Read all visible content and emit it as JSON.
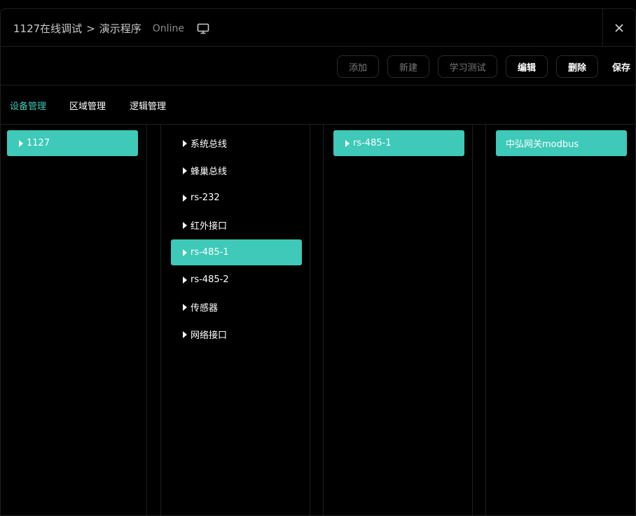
{
  "header": {
    "breadcrumb_root": "1127在线调试",
    "breadcrumb_sep": ">",
    "breadcrumb_current": "演示程序",
    "status": "Online",
    "monitor_icon": "monitor-icon",
    "close_icon": "close-icon"
  },
  "toolbar": {
    "add_label": "添加",
    "new_label": "新建",
    "learn_test_label": "学习测试",
    "edit_label": "编辑",
    "delete_label": "删除",
    "save_label": "保存"
  },
  "tabs": [
    {
      "label": "设备管理",
      "active": true
    },
    {
      "label": "区域管理",
      "active": false
    },
    {
      "label": "逻辑管理",
      "active": false
    }
  ],
  "columns": {
    "col1": [
      {
        "label": "1127",
        "selected": true,
        "expandable": true
      }
    ],
    "col2": [
      {
        "label": "系统总线",
        "selected": false,
        "expandable": true
      },
      {
        "label": "蜂巢总线",
        "selected": false,
        "expandable": true
      },
      {
        "label": "rs-232",
        "selected": false,
        "expandable": true
      },
      {
        "label": "红外接口",
        "selected": false,
        "expandable": true
      },
      {
        "label": "rs-485-1",
        "selected": true,
        "expandable": true
      },
      {
        "label": "rs-485-2",
        "selected": false,
        "expandable": true
      },
      {
        "label": "传感器",
        "selected": false,
        "expandable": true
      },
      {
        "label": "网络接口",
        "selected": false,
        "expandable": true
      }
    ],
    "col3": [
      {
        "label": "rs-485-1",
        "selected": true,
        "expandable": true
      }
    ],
    "col4": [
      {
        "label": "中弘网关modbus",
        "selected": true,
        "expandable": false
      }
    ]
  },
  "colors": {
    "accent": "#3ec9b8",
    "background": "#000000",
    "border": "#1f1f1f"
  }
}
